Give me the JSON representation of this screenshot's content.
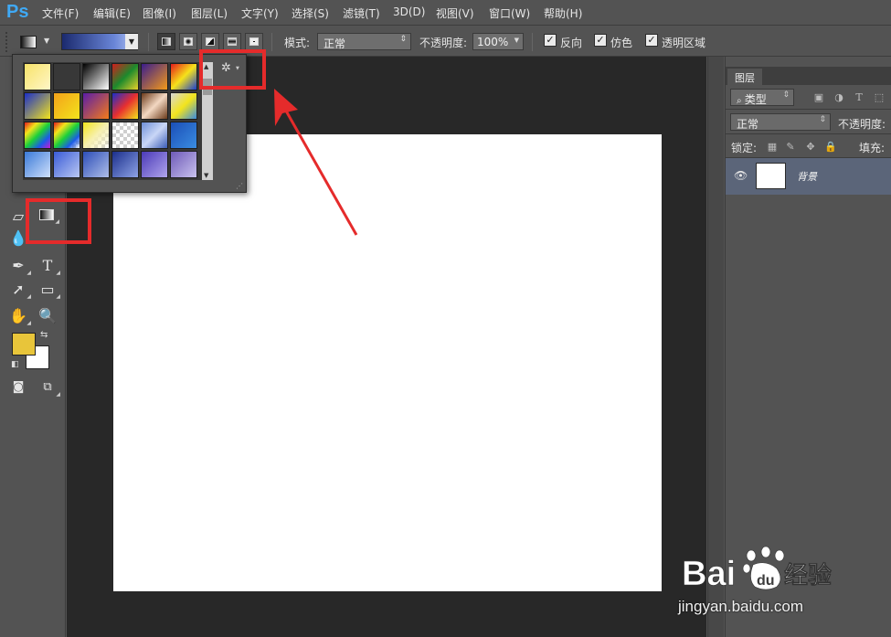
{
  "app": {
    "logo": "Ps"
  },
  "menubar": {
    "items": [
      "文件(F)",
      "编辑(E)",
      "图像(I)",
      "图层(L)",
      "文字(Y)",
      "选择(S)",
      "滤镜(T)",
      "3D(D)",
      "视图(V)",
      "窗口(W)",
      "帮助(H)"
    ]
  },
  "options": {
    "mode_label": "模式:",
    "mode_value": "正常",
    "opacity_label": "不透明度:",
    "opacity_value": "100%",
    "reverse_label": "反向",
    "dither_label": "仿色",
    "transparency_label": "透明区域",
    "gradient_types": [
      "linear",
      "radial",
      "angle",
      "reflected",
      "diamond"
    ]
  },
  "gradient_picker": {
    "gear_icon": "gear-icon",
    "swatches": [
      [
        "#f7e36a,#fff6c7",
        "#e8c23f,checker",
        "#000000,#ffffff",
        "#d11d1d,#1c8a2d,#e8d02a",
        "#3a1d8c,#f49a1a",
        "#e51b1b,#f6e21a,#1b3fd1"
      ],
      [
        "#1b2fc9,#f3e41c",
        "#f3a21a,#f3e41c",
        "#5a1da8,#f47b1a",
        "#1b2fc9,#e82f2f,#f3e41c",
        "#6b3a1a,#f3d8c2,#6b3a1a",
        "#d8d8d8,#f3e41c,#3a8ce0"
      ],
      [
        "#e51b1b,#f3e41c,#1bd13a,#1b5be8,#c91bd1",
        "#e51b1b,#f3e41c,#1bd13a,#1b5be8,checker",
        "#f3e41c,#f7f0b0,checker",
        "checker",
        "#6e8fd8,#c9d6f6,#3a5cb8",
        "#1b4fb8,#3a8ce0"
      ],
      [
        "#3a7ad8,#cfe0fb",
        "#3a5cd8,#b9c7f2",
        "#2d4fb8,#aebde8",
        "#1b2f8c,#8ea3e6",
        "#4b3ab8,#b0a5ec",
        "#6e5ab8,#c9c2ee"
      ]
    ]
  },
  "tools": {
    "fg_color": "#e8c53a",
    "bg_color": "#ffffff"
  },
  "layers": {
    "tab": "图层",
    "kind_label": "类型",
    "blend_mode": "正常",
    "opacity_label": "不透明度:",
    "lock_label": "锁定:",
    "fill_label": "填充:",
    "background_layer_name": "背景"
  },
  "watermark": {
    "brand": "Bai du 经验",
    "url": "jingyan.baidu.com"
  },
  "highlight_color": "#e52b2b"
}
